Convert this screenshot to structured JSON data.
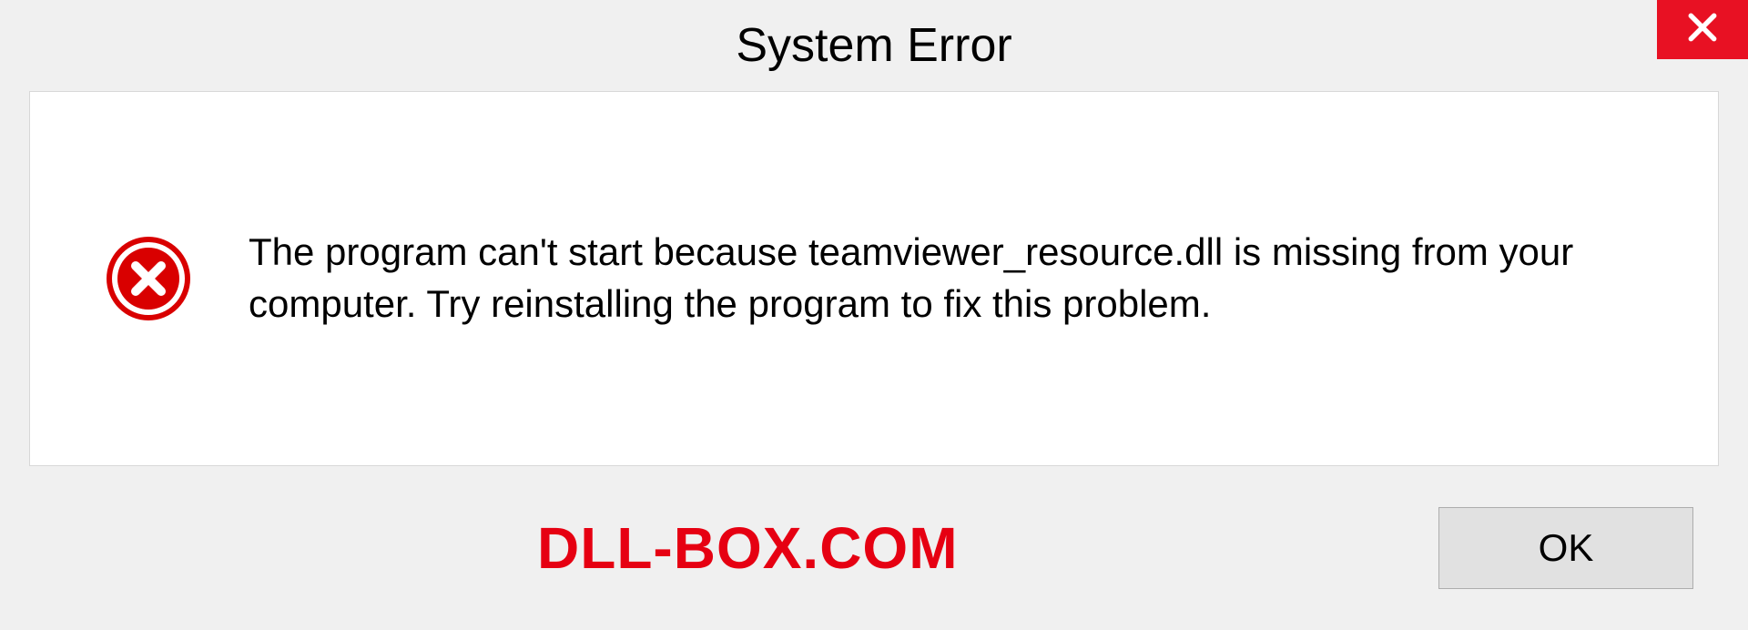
{
  "dialog": {
    "title": "System Error",
    "message": "The program can't start because teamviewer_resource.dll is missing from your computer. Try reinstalling the program to fix this problem.",
    "ok_label": "OK"
  },
  "brand": "DLL-BOX.COM",
  "colors": {
    "close_button": "#e81123",
    "brand_text": "#e60012",
    "error_icon": "#d90000"
  }
}
